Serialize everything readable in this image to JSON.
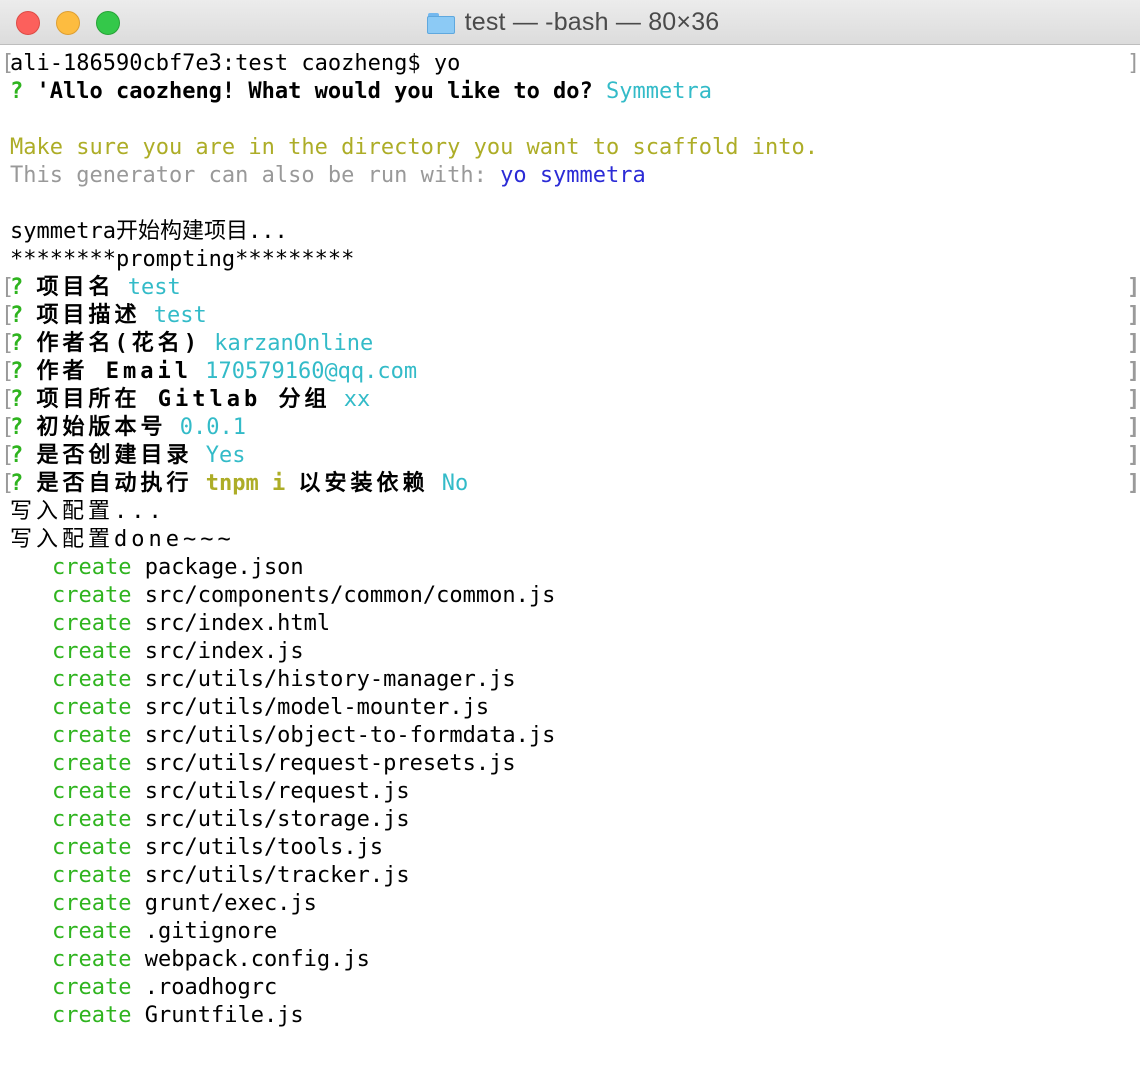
{
  "window": {
    "title": "test — -bash — 80×36"
  },
  "colors": {
    "green": "#2fb41f",
    "cyan": "#33bbc8",
    "yellow": "#adad27",
    "gray": "#999999",
    "purple": "#2b2bd6"
  },
  "terminal": {
    "prompt": "ali-186590cbf7e3:test caozheng$ yo",
    "greeting_q": "?",
    "greeting_text": "'Allo caozheng! What would you like to do?",
    "greeting_choice": "Symmetra",
    "hint_line": "Make sure you are in the directory you want to scaffold into.",
    "run_with_prefix": "This generator can also be run with:",
    "run_with_cmd": "yo symmetra",
    "build_start": "symmetra开始构建项目...",
    "prompting": "********prompting*********",
    "questions": [
      {
        "q": "?",
        "label": "项目名",
        "answer": "test"
      },
      {
        "q": "?",
        "label": "项目描述",
        "answer": "test"
      },
      {
        "q": "?",
        "label": "作者名(花名)",
        "answer": "karzanOnline"
      },
      {
        "q": "?",
        "label": "作者 Email",
        "answer": "170579160@qq.com"
      },
      {
        "q": "?",
        "label": "项目所在 Gitlab 分组",
        "answer": "xx"
      },
      {
        "q": "?",
        "label": "初始版本号",
        "answer": "0.0.1"
      },
      {
        "q": "?",
        "label": "是否创建目录",
        "answer": "Yes"
      }
    ],
    "last_question": {
      "q": "?",
      "label_before": "是否自动执行",
      "highlight": "tnpm i",
      "label_after": "以安装依赖",
      "answer": "No"
    },
    "write_config": "写入配置...",
    "write_config_done": "写入配置done~~~",
    "create_label": "create",
    "created_files": [
      "package.json",
      "src/components/common/common.js",
      "src/index.html",
      "src/index.js",
      "src/utils/history-manager.js",
      "src/utils/model-mounter.js",
      "src/utils/object-to-formdata.js",
      "src/utils/request-presets.js",
      "src/utils/request.js",
      "src/utils/storage.js",
      "src/utils/tools.js",
      "src/utils/tracker.js",
      "grunt/exec.js",
      ".gitignore",
      "webpack.config.js",
      ".roadhogrc",
      "Gruntfile.js"
    ]
  }
}
